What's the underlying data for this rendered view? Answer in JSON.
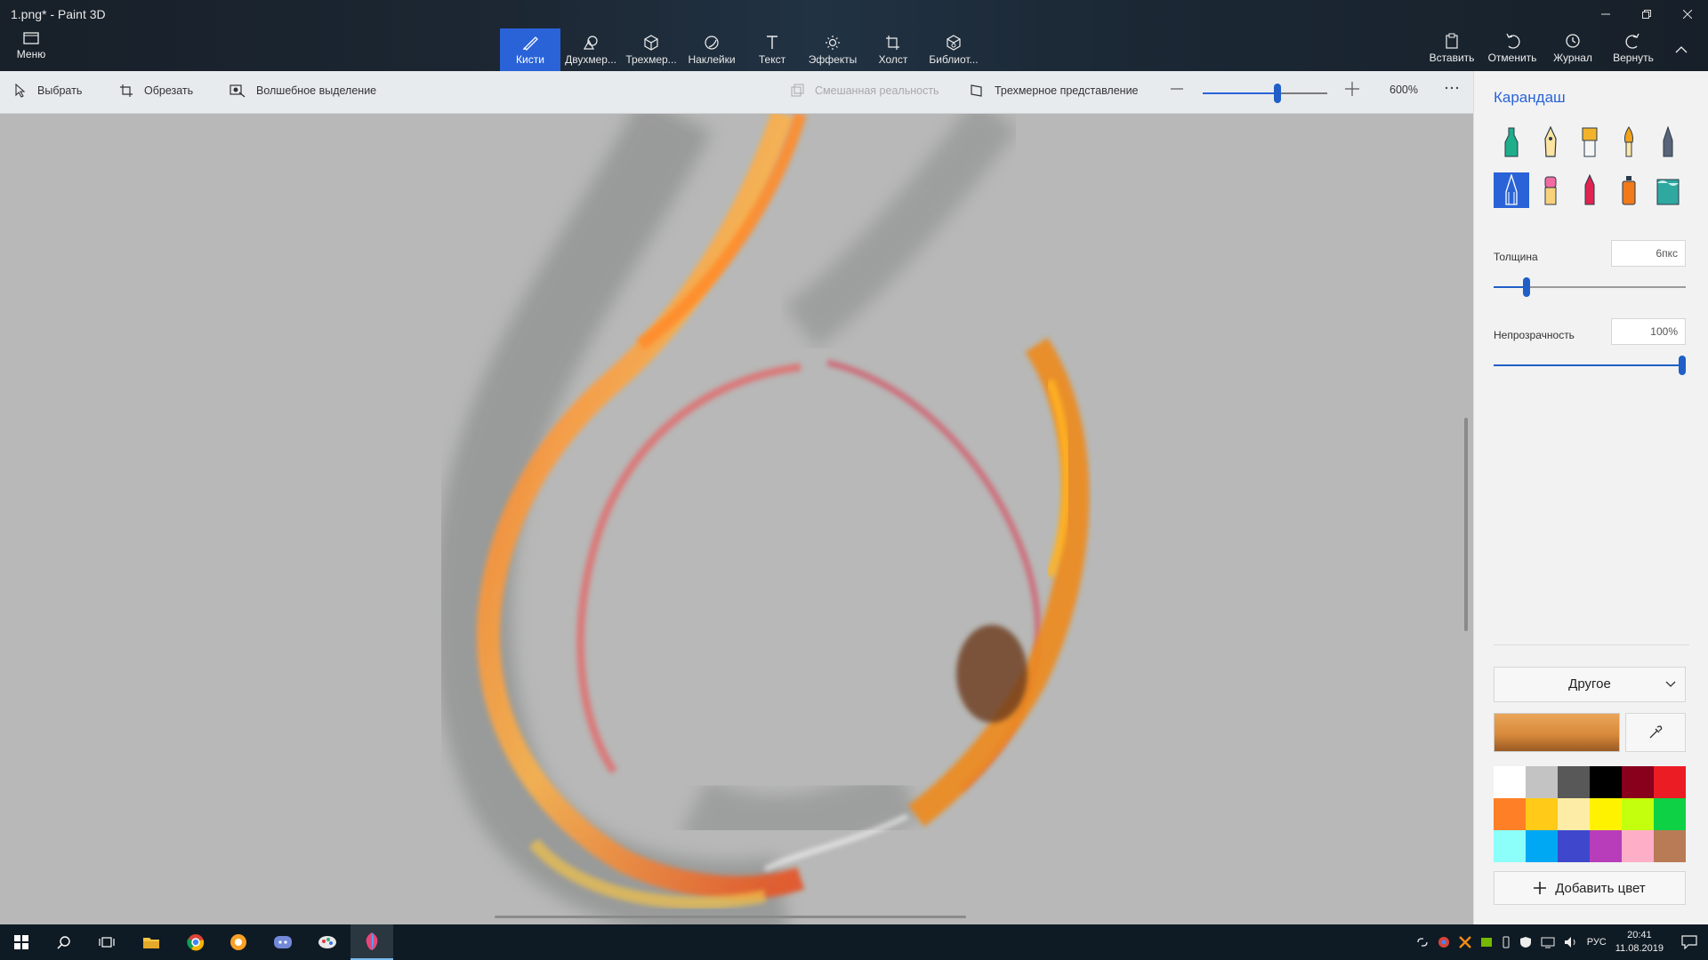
{
  "window": {
    "title": "1.png* - Paint 3D"
  },
  "menu": {
    "label": "Меню"
  },
  "tools": [
    {
      "label": "Кисти",
      "icon": "brush-icon",
      "active": true
    },
    {
      "label": "Двухмер...",
      "icon": "2d-shapes-icon"
    },
    {
      "label": "Трехмер...",
      "icon": "3d-shapes-icon"
    },
    {
      "label": "Наклейки",
      "icon": "stickers-icon"
    },
    {
      "label": "Текст",
      "icon": "text-icon"
    },
    {
      "label": "Эффекты",
      "icon": "effects-icon"
    },
    {
      "label": "Холст",
      "icon": "canvas-icon"
    },
    {
      "label": "Библиот...",
      "icon": "library-icon"
    }
  ],
  "actions": [
    {
      "label": "Вставить",
      "icon": "paste-icon"
    },
    {
      "label": "Отменить",
      "icon": "undo-icon"
    },
    {
      "label": "Журнал",
      "icon": "history-icon"
    },
    {
      "label": "Вернуть",
      "icon": "redo-icon"
    }
  ],
  "subtoolbar": {
    "select": "Выбрать",
    "crop": "Обрезать",
    "magic_select": "Волшебное выделение",
    "mixed_reality": "Смешанная реальность",
    "view_3d": "Трехмерное представление",
    "zoom": "600%",
    "zoom_fraction": 0.6
  },
  "panel": {
    "title": "Карандаш",
    "brushes": [
      {
        "icon": "marker-icon",
        "color": "#1fae8a"
      },
      {
        "icon": "calligraphy-pen-icon",
        "color": "#3a4a6a"
      },
      {
        "icon": "oil-brush-icon",
        "color": "#f2b32a"
      },
      {
        "icon": "watercolor-icon",
        "color": "#f2a21b"
      },
      {
        "icon": "pixel-pen-icon",
        "color": "#5a6478"
      },
      {
        "icon": "pencil-icon",
        "color": "#ffffff",
        "selected": true
      },
      {
        "icon": "eraser-icon",
        "color": "#f06ba0"
      },
      {
        "icon": "crayon-icon",
        "color": "#e0244f"
      },
      {
        "icon": "spraycan-icon",
        "color": "#f07a1a"
      },
      {
        "icon": "fill-icon",
        "color": "#2fa8a0"
      }
    ],
    "thickness_label": "Толщина",
    "thickness_value": "6пкс",
    "thickness_fraction": 0.17,
    "opacity_label": "Непрозрачность",
    "opacity_value": "100%",
    "opacity_fraction": 1.0,
    "color_mode": "Другое",
    "current_color": "#d98a3a",
    "palette": [
      "#ffffff",
      "#c3c3c3",
      "#585858",
      "#000000",
      "#88001b",
      "#ec1c24",
      "#ff7f27",
      "#ffca18",
      "#fdeca6",
      "#fff200",
      "#c4ff0e",
      "#0ed145",
      "#8cfffb",
      "#00a8f3",
      "#3f48cc",
      "#b83dba",
      "#ffaec8",
      "#b97a56"
    ],
    "add_color": "Добавить цвет"
  },
  "taskbar": {
    "apps": [
      "start-icon",
      "search-icon",
      "task-view-icon",
      "file-explorer-icon",
      "chrome-icon",
      "browser-icon",
      "discord-icon",
      "app-icon",
      "paint3d-icon"
    ],
    "lang": "РУС",
    "time": "20:41",
    "date": "11.08.2019"
  }
}
